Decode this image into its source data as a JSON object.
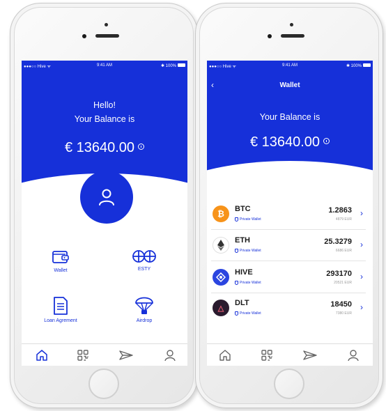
{
  "status_bar": {
    "carrier": "●●●○○ Hive ᯤ",
    "time": "9:41 AM",
    "battery": "✱ 100%"
  },
  "home": {
    "greeting": "Hello!",
    "balance_label": "Your Balance is",
    "balance": "€ 13640.00",
    "tiles": [
      {
        "label": "Wallet",
        "icon": "wallet-icon"
      },
      {
        "label": "ESTY",
        "icon": "esty-icon"
      },
      {
        "label": "Loan Agrement",
        "icon": "document-icon"
      },
      {
        "label": "Airdrop",
        "icon": "parachute-icon"
      }
    ]
  },
  "wallet": {
    "title": "Wallet",
    "back": "‹",
    "balance_label": "Your Balance is",
    "balance": "€ 13640.00",
    "coins": [
      {
        "symbol": "BTC",
        "sub": "Private Wallet",
        "amount": "1.2863",
        "eur": "4879 EUR",
        "color": "#f7931a",
        "glyph": "₿"
      },
      {
        "symbol": "ETH",
        "sub": "Private Wallet",
        "amount": "25.3279",
        "eur": "6686 EUR",
        "color": "#ffffff",
        "glyph": ""
      },
      {
        "symbol": "HIVE",
        "sub": "Private Wallet",
        "amount": "293170",
        "eur": "20521 EUR",
        "color": "#2b45e0",
        "glyph": ""
      },
      {
        "symbol": "DLT",
        "sub": "Private Wallet",
        "amount": "18450",
        "eur": "7380 EUR",
        "color": "#2a1b2e",
        "glyph": "△"
      }
    ]
  },
  "tabs": [
    "home-icon",
    "qr-icon",
    "send-icon",
    "profile-icon"
  ],
  "colors": {
    "accent": "#1630d9",
    "btc": "#f7931a",
    "dlt": "#2a1b2e"
  }
}
